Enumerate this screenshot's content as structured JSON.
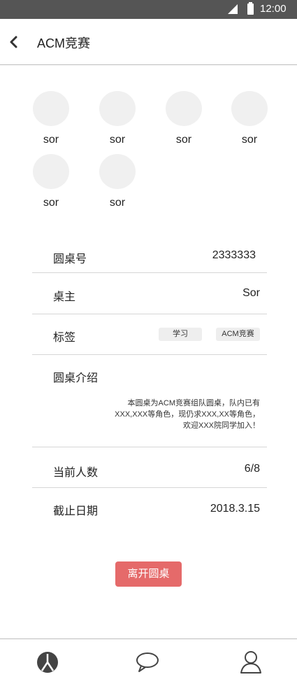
{
  "status_bar": {
    "time": "12:00",
    "background": "#555555"
  },
  "header": {
    "title": "ACM竞赛",
    "back_icon": "chevron-left-icon"
  },
  "members": [
    {
      "name": "sor"
    },
    {
      "name": "sor"
    },
    {
      "name": "sor"
    },
    {
      "name": "sor"
    },
    {
      "name": "sor"
    },
    {
      "name": "sor"
    }
  ],
  "details": {
    "table_id": {
      "label": "圆桌号",
      "value": "2333333"
    },
    "owner": {
      "label": "桌主",
      "value": "Sor"
    },
    "tags": {
      "label": "标签",
      "items": [
        "学习",
        "ACM竞赛"
      ]
    },
    "intro": {
      "label": "圆桌介绍",
      "lines": [
        "本圆桌为ACM竞赛组队圆桌，队内已有",
        "XXX,XXX等角色，现仍求XXX,XX等角色，",
        "欢迎XXX院同学加入！"
      ]
    },
    "member_count": {
      "label": "当前人数",
      "value": "6/8"
    },
    "deadline": {
      "label": "截止日期",
      "value": "2018.3.15"
    }
  },
  "leave_button": {
    "label": "离开圆桌",
    "color": "#e56a6a"
  },
  "tab_bar": {
    "items": [
      "roundtable-icon",
      "chat-bubble-icon",
      "person-icon"
    ]
  }
}
